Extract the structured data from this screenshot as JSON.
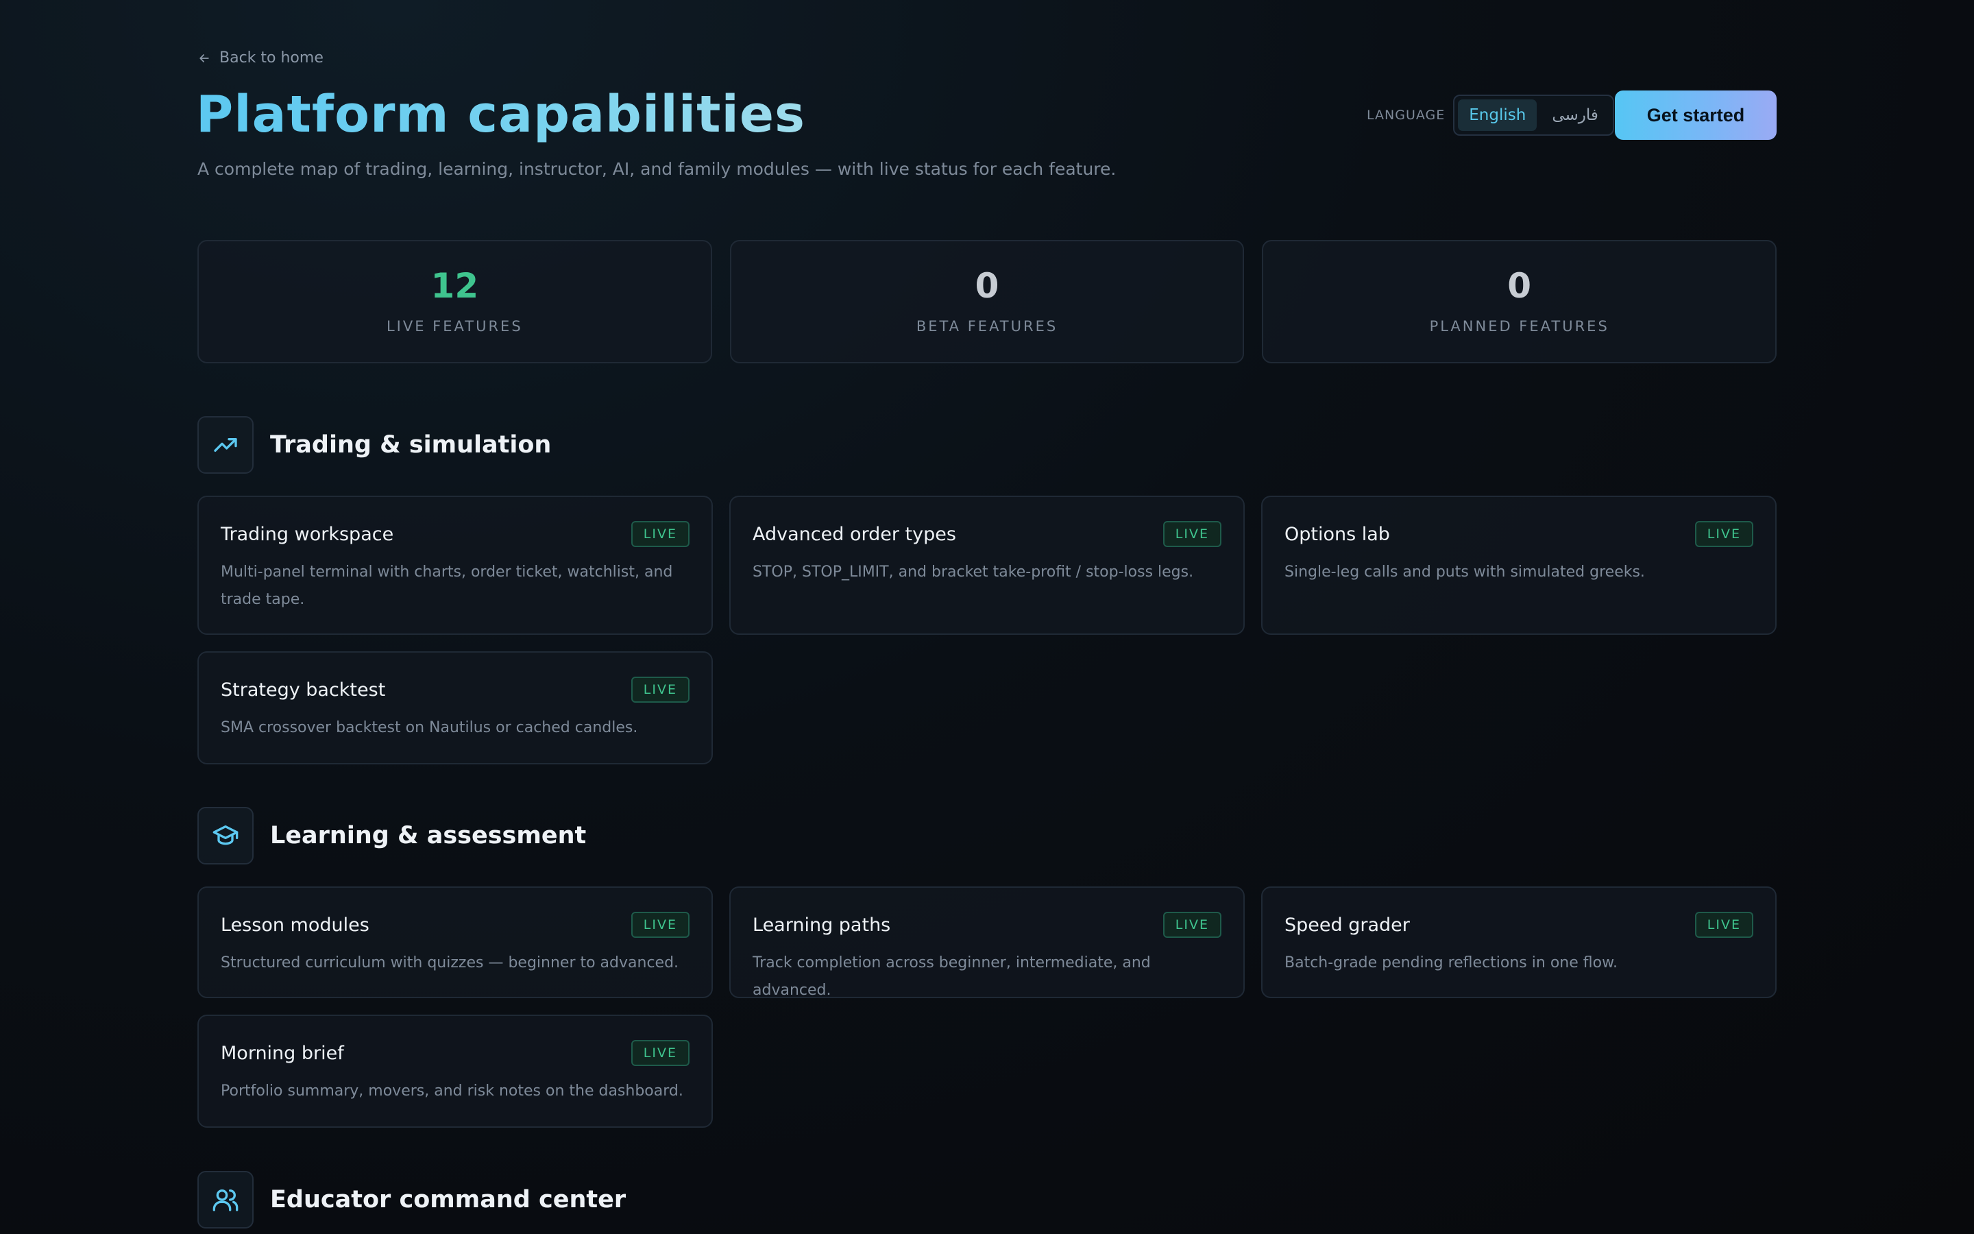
{
  "header": {
    "back_link": "Back to home",
    "title": "Platform capabilities",
    "subtitle": "A complete map of trading, learning, instructor, AI, and family modules — with live status for each feature.",
    "language_label": "LANGUAGE",
    "languages": [
      "English",
      "فارسی"
    ],
    "active_language": "English",
    "cta": "Get started"
  },
  "stats": [
    {
      "value": "12",
      "label": "LIVE FEATURES",
      "color": "#3fc48e"
    },
    {
      "value": "0",
      "label": "BETA FEATURES",
      "color": "#c7ccd3"
    },
    {
      "value": "0",
      "label": "PLANNED FEATURES",
      "color": "#c7ccd3"
    }
  ],
  "sections": [
    {
      "title": "Trading & simulation",
      "icon": "trending-up-icon",
      "features": [
        {
          "title": "Trading workspace",
          "status": "LIVE",
          "description": "Multi-panel terminal with charts, order ticket, watchlist, and trade tape."
        },
        {
          "title": "Advanced order types",
          "status": "LIVE",
          "description": "STOP, STOP_LIMIT, and bracket take-profit / stop-loss legs."
        },
        {
          "title": "Options lab",
          "status": "LIVE",
          "description": "Single-leg calls and puts with simulated greeks."
        },
        {
          "title": "Strategy backtest",
          "status": "LIVE",
          "description": "SMA crossover backtest on Nautilus or cached candles."
        }
      ]
    },
    {
      "title": "Learning & assessment",
      "icon": "graduation-cap-icon",
      "features": [
        {
          "title": "Lesson modules",
          "status": "LIVE",
          "description": "Structured curriculum with quizzes — beginner to advanced."
        },
        {
          "title": "Learning paths",
          "status": "LIVE",
          "description": "Track completion across beginner, intermediate, and advanced."
        },
        {
          "title": "Speed grader",
          "status": "LIVE",
          "description": "Batch-grade pending reflections in one flow."
        },
        {
          "title": "Morning brief",
          "status": "LIVE",
          "description": "Portfolio summary, movers, and risk notes on the dashboard."
        }
      ]
    },
    {
      "title": "Educator command center",
      "icon": "users-icon",
      "features": []
    }
  ],
  "colors": {
    "accent": "#5cc8f0",
    "live": "#3fc48e",
    "background": "#0a0f15"
  }
}
